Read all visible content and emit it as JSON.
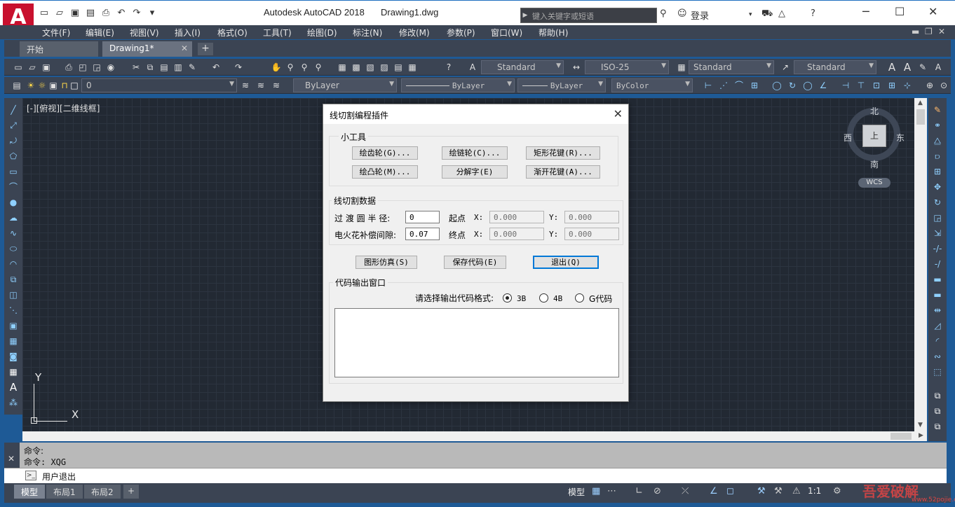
{
  "app": {
    "logo_letter": "A",
    "title": "Autodesk AutoCAD 2018",
    "file": "Drawing1.dwg",
    "search_placeholder": "键入关键字或短语",
    "login": "登录"
  },
  "menu": [
    "文件(F)",
    "编辑(E)",
    "视图(V)",
    "插入(I)",
    "格式(O)",
    "工具(T)",
    "绘图(D)",
    "标注(N)",
    "修改(M)",
    "参数(P)",
    "窗口(W)",
    "帮助(H)"
  ],
  "tabs": {
    "start": "开始",
    "drawing": "Drawing1*",
    "add": "+"
  },
  "toolbar1": {
    "text_style": "Standard",
    "dim_style": "ISO-25",
    "table_style": "Standard",
    "mleader_style": "Standard"
  },
  "toolbar2": {
    "layer": "0",
    "color": "ByLayer",
    "linetype": "ByLayer",
    "lineweight": "ByLayer",
    "plotstyle": "ByColor"
  },
  "viewport_label": "[-][俯视][二维线框]",
  "compass": {
    "n": "北",
    "s": "南",
    "e": "东",
    "w": "西",
    "cube": "上",
    "wcs": "WCS"
  },
  "ucs": {
    "x": "X",
    "y": "Y"
  },
  "command": {
    "line1": "命令:",
    "line2": "命令: XQG",
    "input": "用户退出"
  },
  "layout_tabs": [
    "模型",
    "布局1",
    "布局2"
  ],
  "status_model": "模型",
  "status_scale": "1:1",
  "watermark": "吾爱破解",
  "watermark_url": "www.52pojie.cn",
  "dialog": {
    "title": "线切割编程插件",
    "tools_group": "小工具",
    "btn_gear": "绘齿轮(G)...",
    "btn_chain": "绘链轮(C)...",
    "btn_rect_spline": "矩形花键(R)...",
    "btn_cam": "绘凸轮(M)...",
    "btn_explode": "分解字(E)",
    "btn_involute_spline": "渐开花键(A)...",
    "data_group": "线切割数据",
    "radius_label": "过 渡 圆 半 径:",
    "radius_value": "0",
    "gap_label": "电火花补偿间隙:",
    "gap_value": "0.07",
    "start_label": "起点",
    "end_label": "终点",
    "x_label": "X:",
    "y_label": "Y:",
    "start_x": "0.000",
    "start_y": "0.000",
    "end_x": "0.000",
    "end_y": "0.000",
    "btn_simulate": "图形仿真(S)",
    "btn_save": "保存代码(E)",
    "btn_exit": "退出(Q)",
    "output_group": "代码输出窗口",
    "format_label": "请选择输出代码格式:",
    "opt_3b": "3B",
    "opt_4b": "4B",
    "opt_g": "G代码",
    "output_text": ""
  }
}
